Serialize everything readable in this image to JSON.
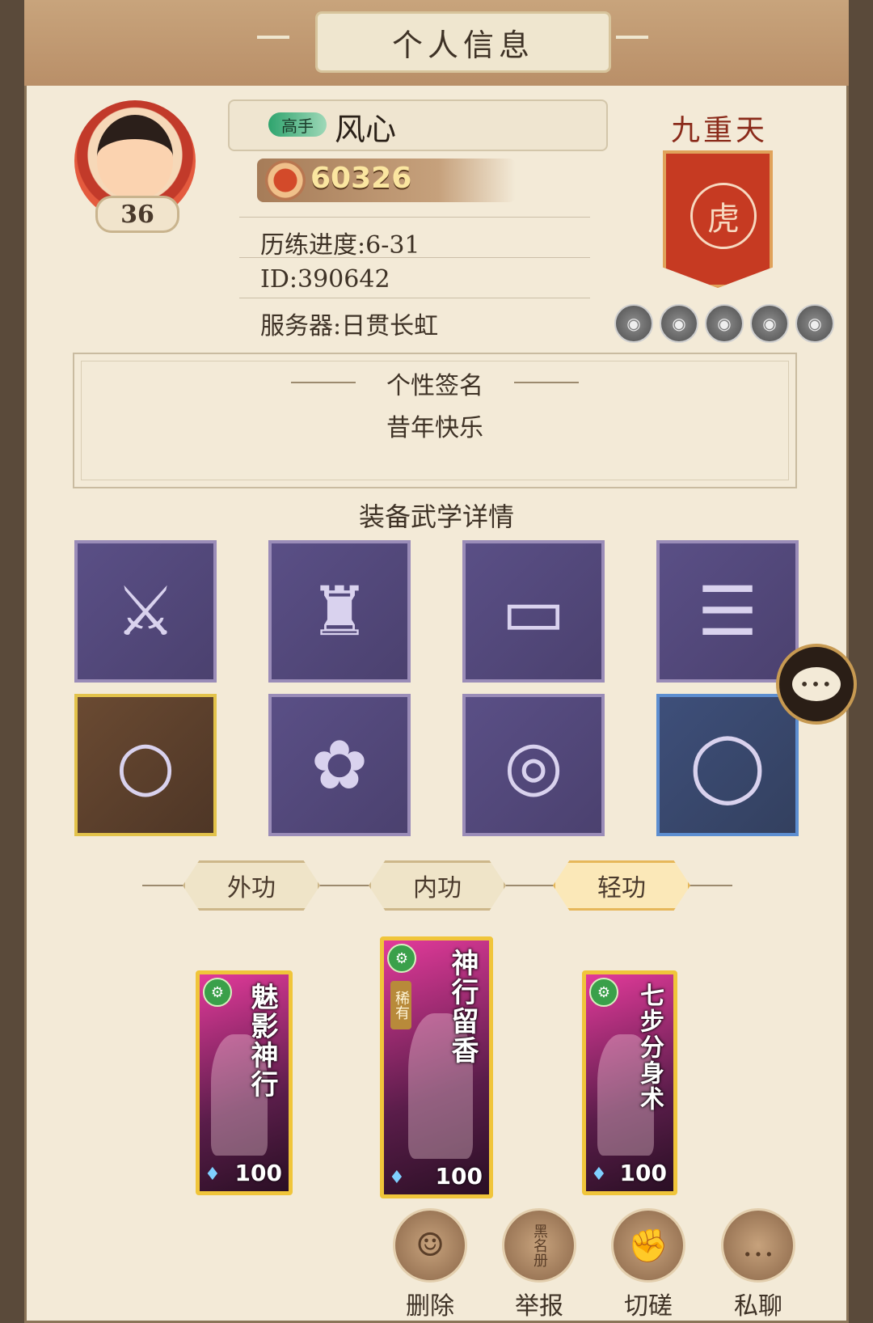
{
  "header": {
    "title": "个人信息"
  },
  "profile": {
    "level": "36",
    "rank_badge": "高手",
    "name": "风心",
    "power": "60326",
    "progress": "历练进度:6-31",
    "id": "ID:390642",
    "server": "服务器:日贯长虹"
  },
  "realm": {
    "title": "九重天",
    "emblem_icon": "tiger-emblem-icon",
    "dots": [
      "wolf-icon",
      "monkey-icon",
      "tiger-icon",
      "demon-icon",
      "dragon-icon"
    ]
  },
  "signature": {
    "title": "个性签名",
    "text": "昔年快乐"
  },
  "equipment": {
    "title": "装备武学详情",
    "slots": [
      {
        "icon": "sabre-icon",
        "rarity": "purple"
      },
      {
        "icon": "armor-icon",
        "rarity": "purple"
      },
      {
        "icon": "belt-icon",
        "rarity": "purple"
      },
      {
        "icon": "boots-icon",
        "rarity": "purple"
      },
      {
        "icon": "bracelet-icon",
        "rarity": "gold"
      },
      {
        "icon": "hairpin-icon",
        "rarity": "purple"
      },
      {
        "icon": "ring-icon",
        "rarity": "purple"
      },
      {
        "icon": "bangle-icon",
        "rarity": "blue"
      }
    ]
  },
  "tabs": [
    {
      "label": "外功",
      "active": false
    },
    {
      "label": "内功",
      "active": false
    },
    {
      "label": "轻功",
      "active": true
    }
  ],
  "skills": [
    {
      "name": "魅影神行",
      "level": "100",
      "rare": false
    },
    {
      "name": "神行留香",
      "level": "100",
      "rare": true,
      "rare_label": "稀有"
    },
    {
      "name": "七步分身术",
      "level": "100",
      "rare": false
    }
  ],
  "actions": [
    {
      "label": "删除",
      "icon": "delete-friend-icon"
    },
    {
      "label": "举报",
      "icon": "blacklist-book-icon",
      "icon_text": "黑名册"
    },
    {
      "label": "切磋",
      "icon": "duel-fist-icon"
    },
    {
      "label": "私聊",
      "icon": "chat-bubble-icon"
    }
  ],
  "colors": {
    "accent": "#c63a22",
    "gold": "#f0c53a",
    "purple_slot": "#5a4f86"
  }
}
